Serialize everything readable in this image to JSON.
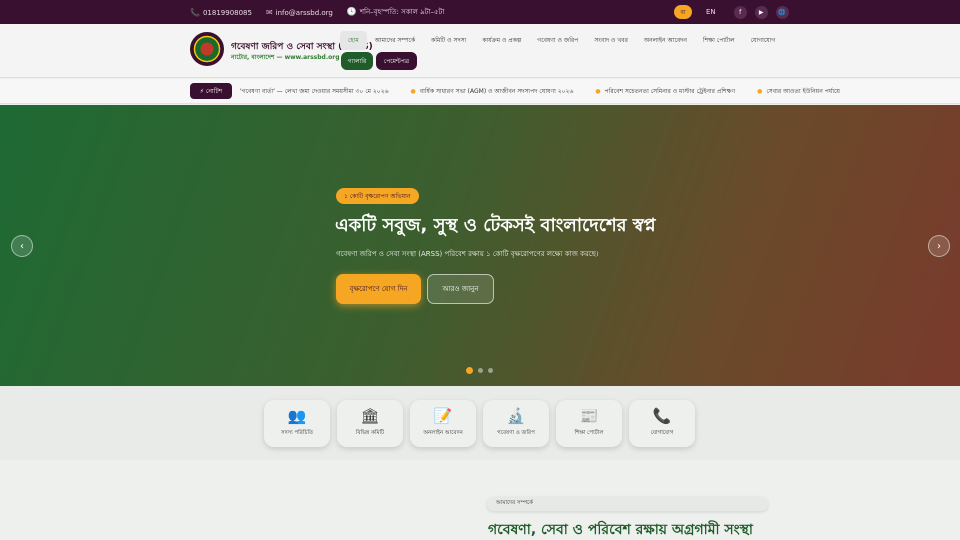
{
  "topbar": {
    "phone": "01819908085",
    "email": "info@arssbd.org",
    "hours": "শনি–বৃহস্পতি: সকাল ৯টা–৫টা",
    "lang_bn": "বা",
    "lang_en": "EN",
    "social": [
      "f",
      "▶",
      "🌐"
    ]
  },
  "header": {
    "brand": "গবেষণা জরিপ ও সেবা সংস্থা (ARSS)",
    "brand_sub": "নাটোর, বাংলাদেশ — www.arssbd.org",
    "nav": [
      "হোম",
      "আমাদের সম্পর্কে",
      "কমিটি ও সদস্য",
      "কার্যক্রম ও প্রকল্প",
      "গবেষণা ও জরিপ",
      "সংবাদ ও খবর",
      "অনলাইন আবেদন",
      "শিক্ষা পোর্টাল",
      "যোগাযোগ"
    ],
    "gallery_label": "গ্যালারি",
    "payment_label": "পেমেন্টপত্র"
  },
  "ticker": {
    "badge": "⚡ নোটিশ",
    "items": [
      "'গবেষণা বার্তা' — লেখা জমা দেওয়ার সময়সীমা ৩০ মে ২০২৬",
      "বার্ষিক সাধারণ সভা (AGM) ও আজীবন সদস্যপদ ঘোষণা ২০২৬",
      "পরিবেশ সচেতনতা সেমিনার ও মাস্টার ট্রেইনার প্রশিক্ষণ",
      "সেবার আওতা ইউনিয়ন পর্যায়ে"
    ]
  },
  "hero": {
    "badge": "১ কোটি বৃক্ষরোপণ অভিযান",
    "title": "একটি সবুজ, সুস্থ ও টেকসই বাংলাদেশের স্বপ্ন",
    "desc": "গবেষণা জরিপ ও সেবা সংস্থা (ARSS) পরিবেশ রক্ষায় ১ কোটি বৃক্ষরোপণের লক্ষ্যে কাজ করছে।",
    "cta": "বৃক্ষরোপণে যোগ দিন",
    "more": "আরও জানুন",
    "prev": "‹",
    "next": "›",
    "slides": 3,
    "active_slide": 1
  },
  "quick_links": [
    {
      "icon": "👥",
      "label": "সদস্য পরিচিতি"
    },
    {
      "icon": "🏛",
      "label": "বিভিন্ন কমিটি"
    },
    {
      "icon": "📝",
      "label": "অনলাইন আবেদন"
    },
    {
      "icon": "🔬",
      "label": "গবেষণা ও জরিপ"
    },
    {
      "icon": "📰",
      "label": "শিক্ষা পোর্টাল"
    },
    {
      "icon": "📞",
      "label": "যোগাযোগ"
    }
  ],
  "about": {
    "tag": "আমাদের সম্পর্কে",
    "title": "গবেষণা, সেবা ও পরিবেশ রক্ষায় অগ্রগামী সংস্থা"
  },
  "colors": {
    "primary_dark": "#3a1030",
    "accent": "#f5a623",
    "green": "#1f5c2a"
  }
}
